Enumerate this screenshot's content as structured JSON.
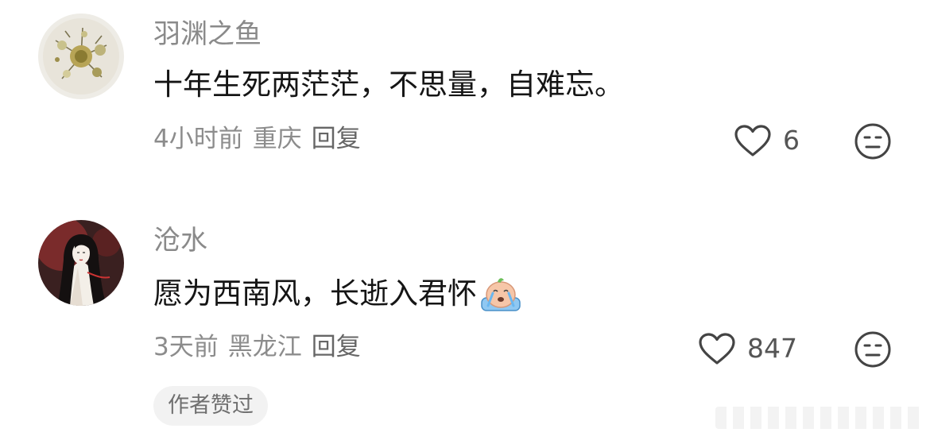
{
  "comments": [
    {
      "username": "羽渊之鱼",
      "text": "十年生死两茫茫，不思量，自难忘。",
      "time": "4小时前",
      "location": "重庆",
      "reply_label": "回复",
      "like_count": "6",
      "avatar_icon": "dried-flower-avatar"
    },
    {
      "username": "沧水",
      "text": "愿为西南风，长逝入君怀",
      "emoji_icon": "crying-emoji",
      "time": "3天前",
      "location": "黑龙江",
      "reply_label": "回复",
      "like_count": "847",
      "avatar_icon": "ink-painting-woman-avatar",
      "badge": "作者赞过"
    }
  ],
  "icons": {
    "like": "heart-outline-icon",
    "dislike": "neutral-face-icon"
  },
  "colors": {
    "username": "#8a8a8a",
    "text": "#151515",
    "meta": "#8c8c8c",
    "badge_bg": "#f2f2f2"
  }
}
